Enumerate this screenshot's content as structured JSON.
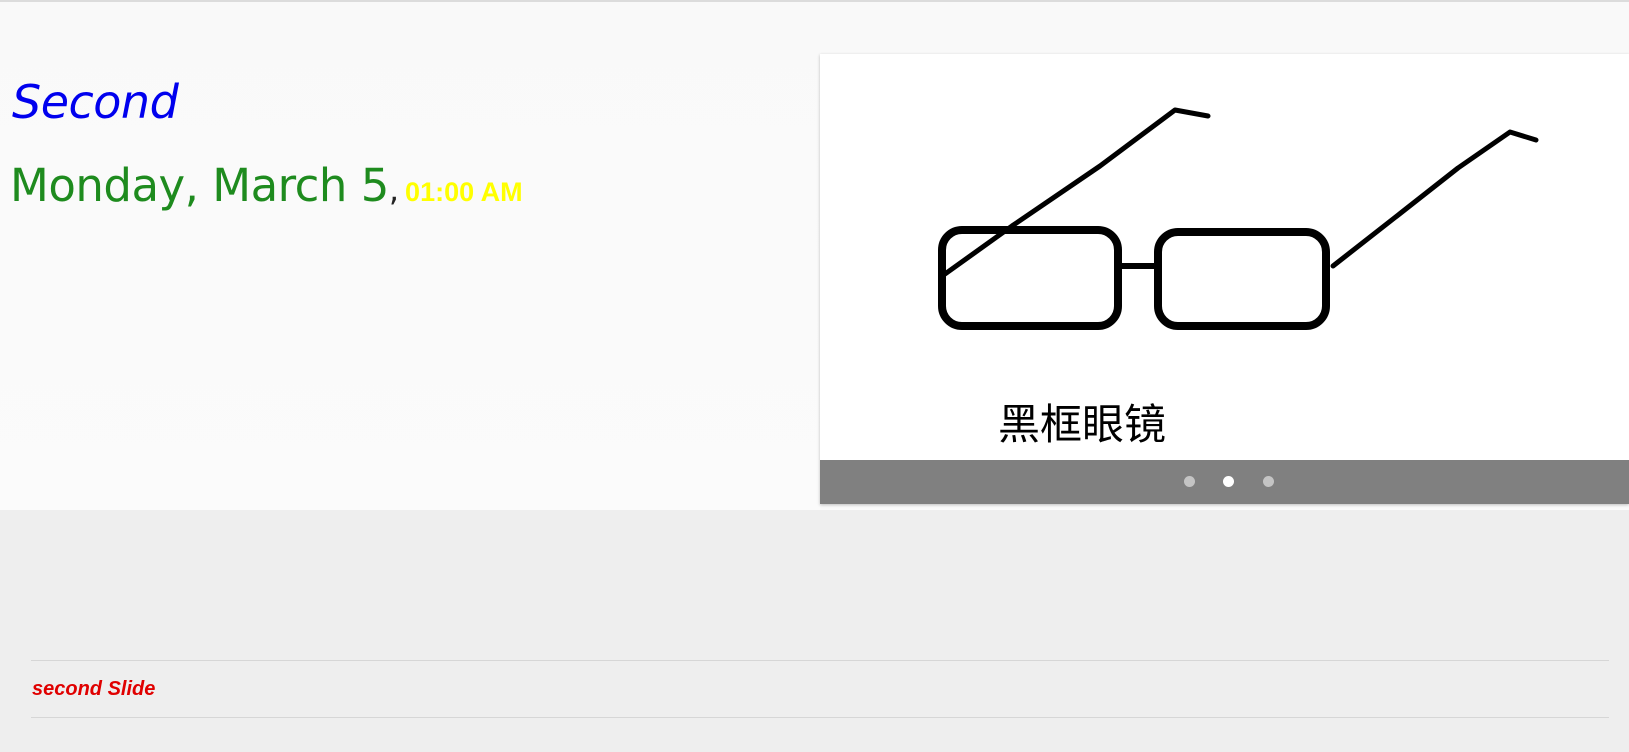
{
  "hero": {
    "title": "Second",
    "date": "Monday, March 5",
    "separator": ",",
    "time": "01:00 AM"
  },
  "carousel": {
    "caption": "黑框眼镜",
    "image_icon": "glasses-icon",
    "slide_count": 3,
    "active_index": 1
  },
  "footer": {
    "items": [
      {
        "label": "second Slide"
      }
    ]
  },
  "colors": {
    "title": "#0000ee",
    "date": "#1e8b1e",
    "time": "#ffff00",
    "footer_text": "#e00000",
    "indicator_bar": "#808080"
  }
}
